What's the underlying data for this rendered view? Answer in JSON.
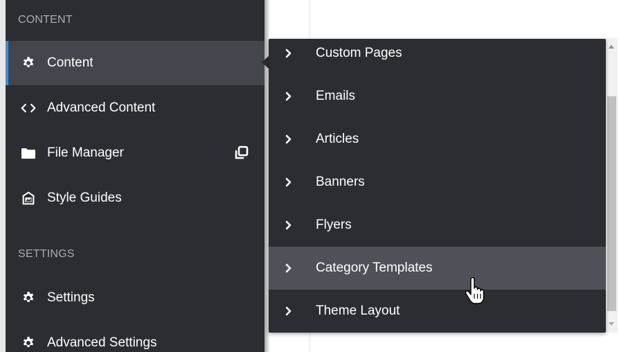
{
  "sidebar": {
    "sections": [
      {
        "header": "CONTENT"
      },
      {
        "header": "SETTINGS"
      }
    ],
    "items": [
      {
        "label": "Content",
        "icon": "gear-icon",
        "active": true
      },
      {
        "label": "Advanced Content",
        "icon": "code-icon"
      },
      {
        "label": "File Manager",
        "icon": "folder-icon",
        "action_icon": "popout-window-icon"
      },
      {
        "label": "Style Guides",
        "icon": "style-guide-icon"
      },
      {
        "label": "Settings",
        "icon": "gear-icon"
      },
      {
        "label": "Advanced Settings",
        "icon": "gear-icon"
      }
    ]
  },
  "flyout": {
    "items": [
      {
        "label": "Custom Pages"
      },
      {
        "label": "Emails"
      },
      {
        "label": "Articles"
      },
      {
        "label": "Banners"
      },
      {
        "label": "Flyers"
      },
      {
        "label": "Category Templates",
        "hovered": true
      },
      {
        "label": "Theme Layout"
      }
    ]
  },
  "colors": {
    "sidebar_bg": "#2b2d33",
    "active_bg": "#43464d",
    "active_accent": "#3c8fd8",
    "hover_bg": "#4e5158",
    "section_header": "#a8acb3",
    "text": "#ffffff"
  }
}
